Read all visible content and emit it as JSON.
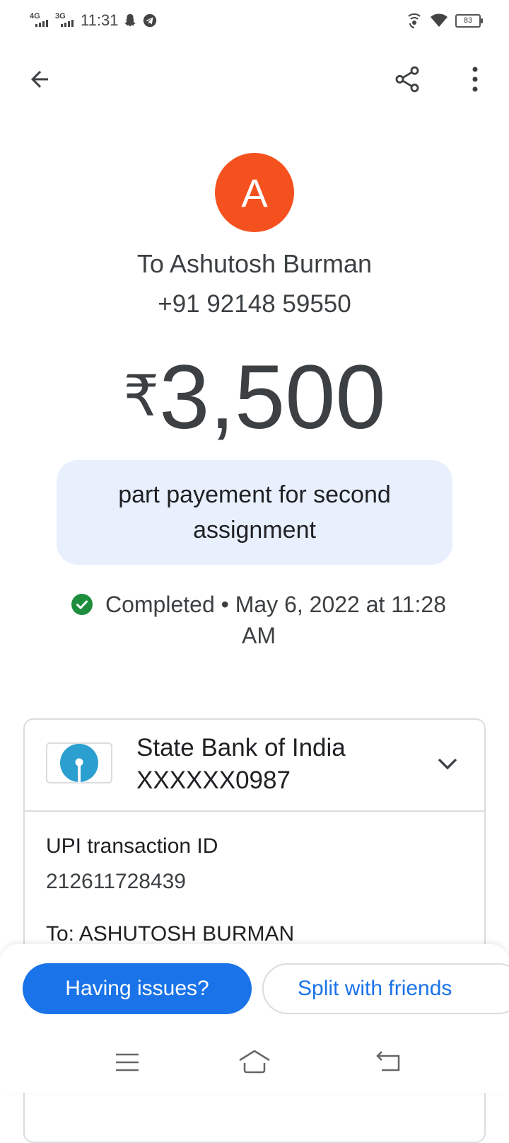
{
  "status_bar": {
    "network1": "4G",
    "network2": "3G",
    "time": "11:31",
    "battery": "83"
  },
  "app_bar": {
    "back_icon": "arrow-left-icon",
    "share_icon": "share-icon",
    "more_icon": "more-vertical-icon"
  },
  "recipient": {
    "avatar_letter": "A",
    "avatar_color": "#f4511e",
    "name": "To Ashutosh Burman",
    "phone": "+91 92148 59550"
  },
  "payment": {
    "currency_symbol": "₹",
    "amount": "3,500",
    "note": "part payement for second assignment",
    "status": "Completed",
    "separator": "•",
    "datetime": "May 6, 2022 at 11:28 AM"
  },
  "details": {
    "bank_name": "State Bank of India",
    "account": "XXXXXX0987",
    "upi_label": "UPI transaction ID",
    "upi_id": "212611728439",
    "to_label": "To: ASHUTOSH BURMAN"
  },
  "actions": {
    "having_issues": "Having issues?",
    "split": "Split with friends"
  },
  "colors": {
    "accent": "#1a73e8",
    "success": "#1e8e3e",
    "note_bg": "#e8f0fe"
  }
}
